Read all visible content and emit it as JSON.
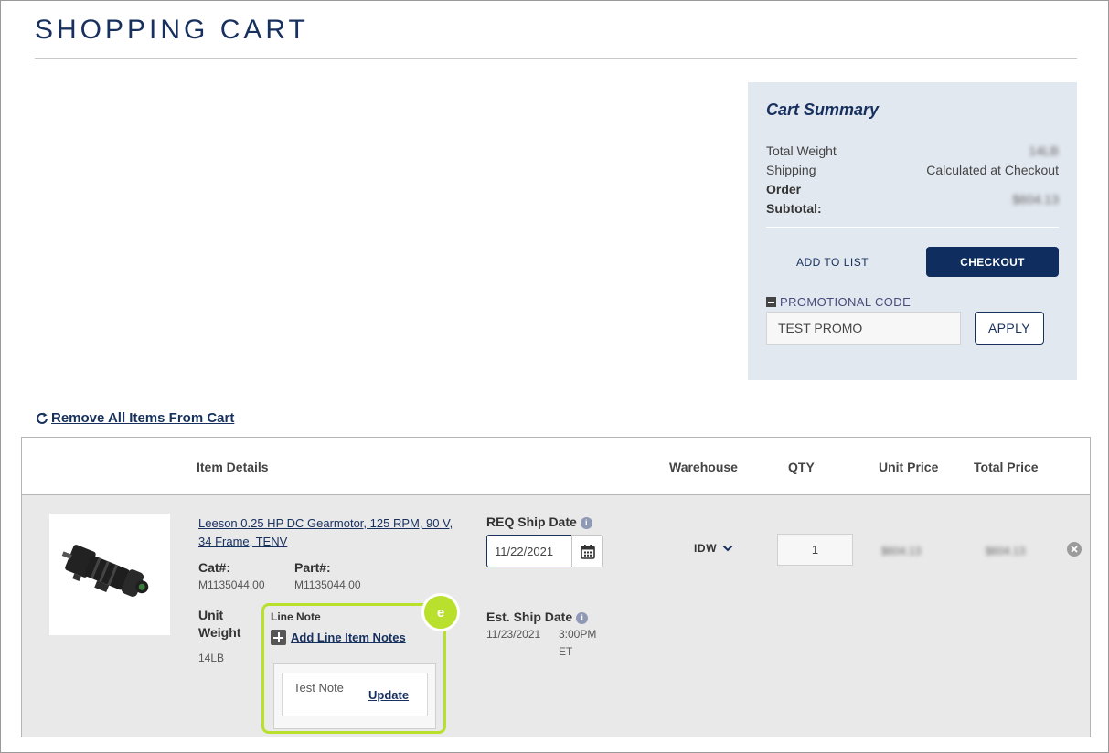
{
  "page": {
    "title": "SHOPPING CART"
  },
  "summary": {
    "title": "Cart Summary",
    "total_weight_label": "Total Weight",
    "total_weight_value": "14LB",
    "shipping_label": "Shipping",
    "shipping_value": "Calculated at Checkout",
    "subtotal_label_1": "Order",
    "subtotal_label_2": "Subtotal:",
    "subtotal_value": "$604.13",
    "add_to_list": "ADD TO LIST",
    "checkout": "CHECKOUT",
    "promo_label": "PROMOTIONAL CODE",
    "promo_value": "TEST PROMO",
    "apply": "APPLY"
  },
  "remove_all": "Remove All Items From Cart",
  "table": {
    "headers": {
      "item_details": "Item Details",
      "warehouse": "Warehouse",
      "qty": "QTY",
      "unit_price": "Unit Price",
      "total_price": "Total Price"
    },
    "row": {
      "product_name": "Leeson 0.25 HP DC Gearmotor, 125 RPM, 90 V, 34 Frame, TENV",
      "cat_label": "Cat#:",
      "cat_value": "M1135044.00",
      "part_label": "Part#:",
      "part_value": "M1135044.00",
      "unit_weight_label_1": "Unit",
      "unit_weight_label_2": "Weight",
      "unit_weight_value": "14LB",
      "line_note_title": "Line Note",
      "add_line_notes": "Add Line Item Notes",
      "note_text": "Test Note",
      "update": "Update",
      "badge": "e",
      "req_ship_label": "REQ Ship Date",
      "req_ship_value": "11/22/2021",
      "est_ship_label": "Est. Ship Date",
      "est_ship_date": "11/23/2021",
      "est_ship_time": "3:00PM",
      "est_ship_tz": "ET",
      "warehouse": "IDW",
      "qty": "1",
      "unit_price": "$604.13",
      "total_price": "$604.13"
    }
  },
  "colors": {
    "navy": "#17305e",
    "highlight": "#b8e02c",
    "summary_bg": "#e2e8f0",
    "row_bg": "#e9e9e9"
  },
  "icons": [
    "refresh-icon",
    "minus-square-icon",
    "plus-square-icon",
    "info-icon",
    "calendar-icon",
    "chevron-down-icon",
    "close-circle-icon"
  ]
}
